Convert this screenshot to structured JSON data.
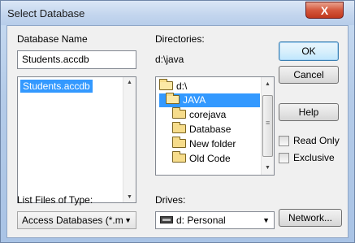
{
  "window": {
    "title": "Select Database",
    "close_glyph": "X"
  },
  "database_name": {
    "label": "Database Name",
    "value": "Students.accdb"
  },
  "file_list": {
    "items": [
      "Students.accdb"
    ],
    "selected": "Students.accdb"
  },
  "directories": {
    "label": "Directories:",
    "current_path": "d:\\java",
    "items": [
      {
        "name": "d:\\",
        "icon": "open-folder-icon"
      },
      {
        "name": "JAVA",
        "icon": "open-folder-icon",
        "selected": true
      },
      {
        "name": "corejava",
        "icon": "folder-icon"
      },
      {
        "name": "Database",
        "icon": "folder-icon"
      },
      {
        "name": "New folder",
        "icon": "folder-icon"
      },
      {
        "name": "Old Code",
        "icon": "folder-icon"
      }
    ]
  },
  "buttons": {
    "ok": "OK",
    "cancel": "Cancel",
    "help": "Help",
    "network": "Network..."
  },
  "options": {
    "read_only": "Read Only",
    "exclusive": "Exclusive"
  },
  "file_type": {
    "label": "List Files of Type:",
    "value": "Access Databases (*.m"
  },
  "drives": {
    "label": "Drives:",
    "value": "d: Personal"
  },
  "colors": {
    "selection": "#3399ff",
    "titlebar": "#c4d6ee",
    "close": "#c0381d"
  }
}
